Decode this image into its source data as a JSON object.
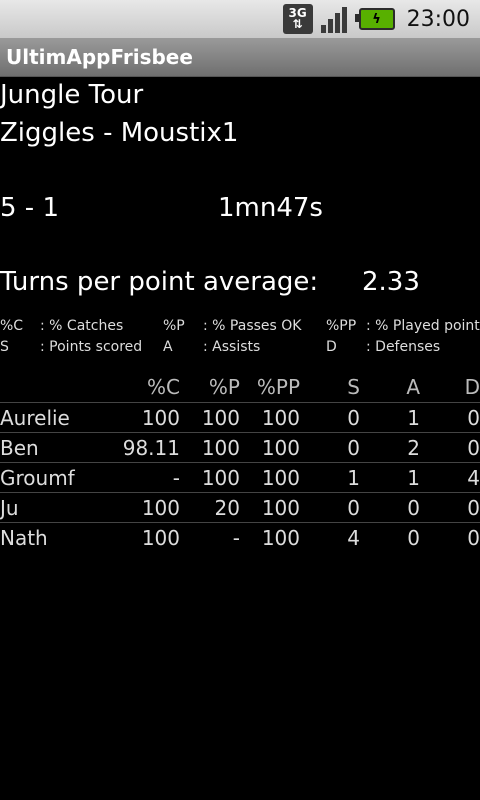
{
  "status": {
    "network": "3G",
    "time": "23:00"
  },
  "app_title": "UltimAppFrisbee",
  "match": {
    "tournament": "Jungle Tour",
    "teams": "Ziggles - Moustix1",
    "score": "5 - 1",
    "duration": "1mn47s",
    "turns_label": "Turns per point average:",
    "turns_value": "2.33"
  },
  "legend": [
    {
      "abbr": "%C",
      "desc": ": % Catches"
    },
    {
      "abbr": "%P",
      "desc": ": % Passes OK"
    },
    {
      "abbr": "%PP",
      "desc": ": % Played points"
    },
    {
      "abbr": "S",
      "desc": ": Points scored"
    },
    {
      "abbr": "A",
      "desc": ": Assists"
    },
    {
      "abbr": "D",
      "desc": ": Defenses"
    }
  ],
  "table": {
    "headers": [
      "",
      "%C",
      "%P",
      "%PP",
      "S",
      "A",
      "D"
    ],
    "rows": [
      [
        "Aurelie",
        "100",
        "100",
        "100",
        "0",
        "1",
        "0"
      ],
      [
        "Ben",
        "98.11",
        "100",
        "100",
        "0",
        "2",
        "0"
      ],
      [
        "Groumf",
        "-",
        "100",
        "100",
        "1",
        "1",
        "4"
      ],
      [
        "Ju",
        "100",
        "20",
        "100",
        "0",
        "0",
        "0"
      ],
      [
        "Nath",
        "100",
        "-",
        "100",
        "4",
        "0",
        "0"
      ]
    ]
  }
}
